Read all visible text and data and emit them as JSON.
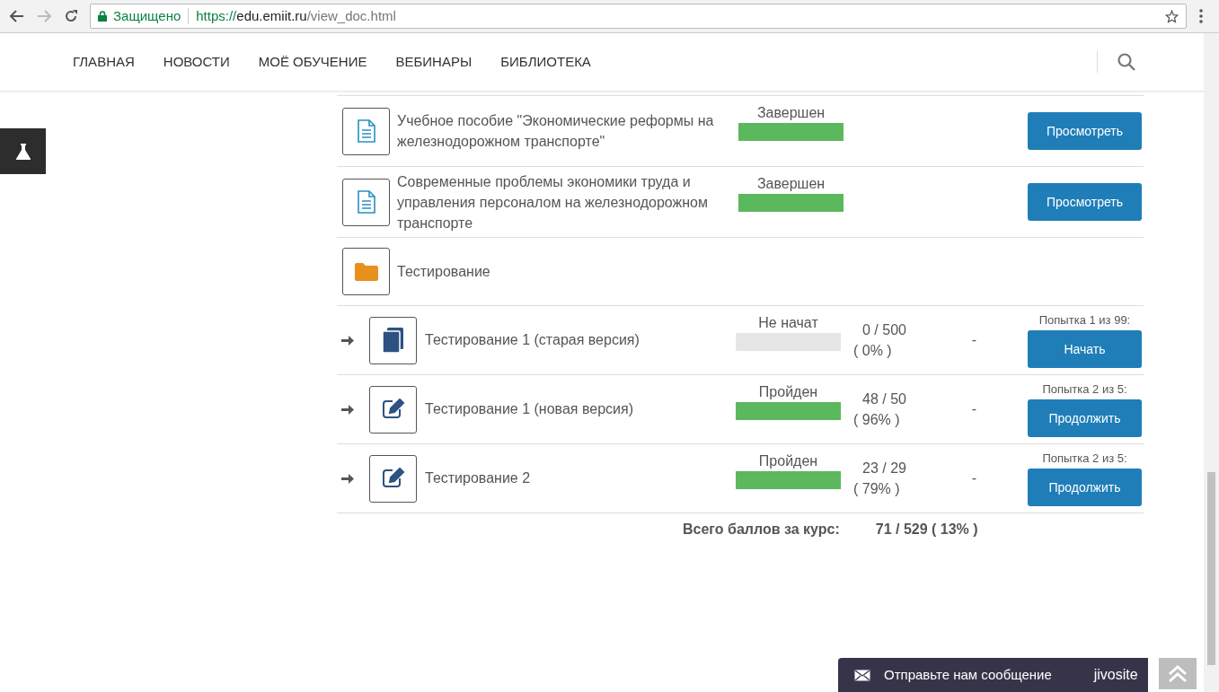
{
  "browser": {
    "secure_label": "Защищено",
    "url_scheme": "https://",
    "url_host": "edu.emiit.ru",
    "url_path": "/view_doc.html"
  },
  "nav": [
    {
      "label": "ГЛАВНАЯ"
    },
    {
      "label": "НОВОСТИ"
    },
    {
      "label": "МОЁ ОБУЧЕНИЕ"
    },
    {
      "label": "ВЕБИНАРЫ"
    },
    {
      "label": "БИБЛИОТЕКА"
    }
  ],
  "items": [
    {
      "kind": "document",
      "title": "Учебное пособие \"Экономические реформы на железнодорожном транспорте\"",
      "status": "Завершен",
      "level": 1,
      "button": "Просмотреть"
    },
    {
      "kind": "document",
      "title": "Современные проблемы экономики труда и управления персоналом на железнодорожном транспорте",
      "status": "Завершен",
      "level": 1,
      "button": "Просмотреть"
    },
    {
      "kind": "folder",
      "title": "Тестирование"
    },
    {
      "kind": "book",
      "title": "Тестирование 1 (старая версия)",
      "status": "Не начат",
      "level": 0,
      "score": "0 / 500",
      "percent": "( 0% )",
      "column_4": "-",
      "attempt": "Попытка 1 из 99:",
      "button": "Начать"
    },
    {
      "kind": "assignment",
      "title": "Тестирование 1 (новая версия)",
      "status": "Пройден",
      "level": 1,
      "score": "48 / 50",
      "percent": "( 96% )",
      "column_4": "-",
      "attempt": "Попытка 2 из 5:",
      "button": "Продолжить"
    },
    {
      "kind": "assignment",
      "title": "Тестирование 2",
      "status": "Пройден",
      "level": 1,
      "score": "23 / 29",
      "percent": "( 79% )",
      "column_4": "-",
      "attempt": "Попытка 2 из 5:",
      "button": "Продолжить"
    }
  ],
  "total": {
    "label": "Всего баллов за курс:",
    "value": "71 / 529 ( 13% )"
  },
  "chat": {
    "label": "Отправьте нам сообщение",
    "brand": "jivosite"
  }
}
